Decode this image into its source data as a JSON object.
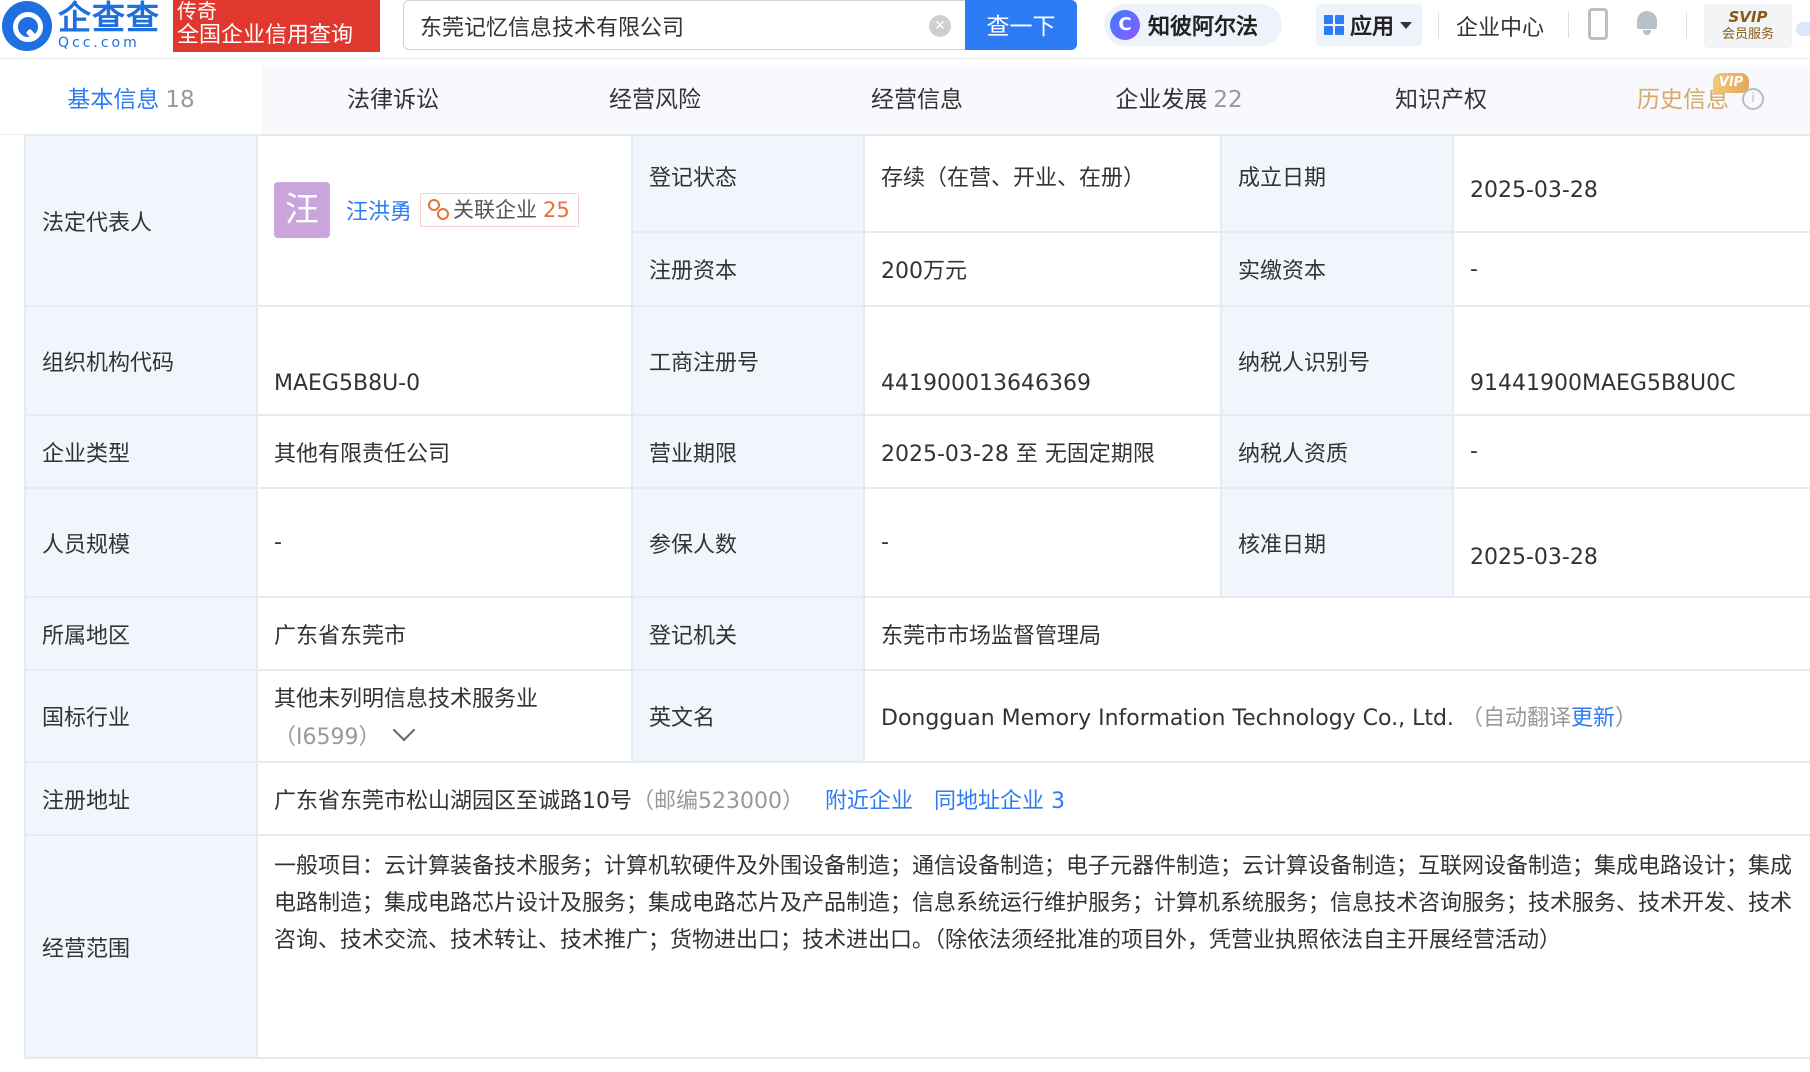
{
  "header": {
    "logo_cn": "企查查",
    "logo_en": "Qcc.com",
    "slogan_top": "传奇",
    "slogan_bottom": "全国企业信用查询",
    "search_value": "东莞记忆信息技术有限公司",
    "search_button": "查一下",
    "ai_icon_letter": "C",
    "ai_label": "知彼阿尔法",
    "app_label": "应用",
    "enterprise_center": "企业中心",
    "svip_top": "SVIP",
    "svip_bottom": "会员服务"
  },
  "tabs": [
    {
      "label": "基本信息",
      "count": "18"
    },
    {
      "label": "法律诉讼",
      "count": ""
    },
    {
      "label": "经营风险",
      "count": ""
    },
    {
      "label": "经营信息",
      "count": ""
    },
    {
      "label": "企业发展",
      "count": "22"
    },
    {
      "label": "知识产权",
      "count": ""
    },
    {
      "label": "历史信息",
      "count": ""
    }
  ],
  "vip_tag": "VIP",
  "info_icon_glyph": "i",
  "company": {
    "legal_rep_label": "法定代表人",
    "legal_rep_avatar": "汪",
    "legal_rep_name": "汪洪勇",
    "related_label": "关联企业",
    "related_count": "25",
    "reg_status_label": "登记状态",
    "reg_status": "存续（在营、开业、在册）",
    "found_date_label": "成立日期",
    "found_date": "2025-03-28",
    "reg_capital_label": "注册资本",
    "reg_capital": "200万元",
    "paid_capital_label": "实缴资本",
    "paid_capital": "-",
    "org_code_label": "组织机构代码",
    "org_code": "MAEG5B8U-0",
    "biz_reg_no_label": "工商注册号",
    "biz_reg_no": "441900013646369",
    "taxpayer_id_label": "纳税人识别号",
    "taxpayer_id": "91441900MAEG5B8U0C",
    "type_label": "企业类型",
    "type": "其他有限责任公司",
    "term_label": "营业期限",
    "term": "2025-03-28 至 无固定期限",
    "taxpayer_qual_label": "纳税人资质",
    "taxpayer_qual": "-",
    "staff_label": "人员规模",
    "staff": "-",
    "insured_label": "参保人数",
    "insured": "-",
    "approve_date_label": "核准日期",
    "approve_date": "2025-03-28",
    "region_label": "所属地区",
    "region": "广东省东莞市",
    "authority_label": "登记机关",
    "authority": "东莞市市场监督管理局",
    "industry_label": "国标行业",
    "industry": "其他未列明信息技术服务业",
    "industry_code": "（I6599）",
    "en_name_label": "英文名",
    "en_name": "Dongguan Memory Information Technology Co., Ltd.",
    "en_auto_prefix": "（自动翻译",
    "en_update_link": "更新",
    "en_auto_suffix": "）",
    "address_label": "注册地址",
    "address": "广东省东莞市松山湖园区至诚路10号",
    "postcode": "（邮编523000）",
    "nearby_link": "附近企业",
    "same_addr_link": "同地址企业 3",
    "scope_label": "经营范围",
    "scope": "一般项目：云计算装备技术服务；计算机软硬件及外围设备制造；通信设备制造；电子元器件制造；云计算设备制造；互联网设备制造；集成电路设计；集成电路制造；集成电路芯片设计及服务；集成电路芯片及产品制造；信息系统运行维护服务；计算机系统服务；信息技术咨询服务；技术服务、技术开发、技术咨询、技术交流、技术转让、技术推广；货物进出口；技术进出口。（除依法须经批准的项目外，凭营业执照依法自主开展经营活动）"
  }
}
